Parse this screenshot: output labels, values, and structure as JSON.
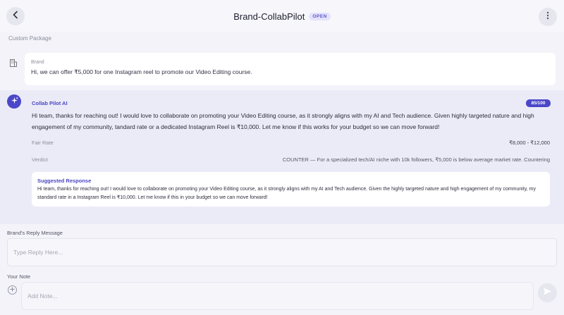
{
  "header": {
    "title": "Brand-CollabPilot",
    "status_badge": "OPEN",
    "back_icon": "chevron-left-icon",
    "menu_icon": "vertical-dots-icon"
  },
  "breadcrumb": "Custom Package",
  "brand_message": {
    "icon": "building-icon",
    "label": "Brand",
    "text": "Hi, we can offer ₹5,000 for one Instagram reel to promote our Video Editing course."
  },
  "ai_message": {
    "icon": "sparkles-icon",
    "name": "Collab Pilot AI",
    "score": "85/100",
    "text": "Hi team, thanks for reaching out! I would love to collaborate on promoting your Video Editing course, as it strongly aligns with my AI and Tech audience. Given highly targeted nature and high engagement of my community, tandard rate or a dedicated Instagram Reel is ₹10,000. Let me know if this works for your budget so we can move forward!",
    "fair_rate_label": "Fair Rate",
    "fair_rate_value": "₹8,000 - ₹12,000",
    "verdict_label": "Verdict",
    "verdict_value": "COUNTER — For a specialized tech/AI niche with 10k followers, ₹5,000 is below average market rate. Countering",
    "suggested": {
      "title": "Suggested Response",
      "text": "Hi team, thanks for reaching out! I would love to collaborate on promoting your Video Editing course, as it strongly aligns with my AI and Tech audience. Given the highly targeted nature and high engagement of my community, my standard rate in a Instagram Reel is ₹10,000. Let me know if this in your budget so we can move forward!"
    }
  },
  "reply": {
    "label": "Brand's Reply Message",
    "placeholder": "Type Reply Here..."
  },
  "note": {
    "label": "Your Note",
    "placeholder": "Add Note...",
    "add_icon": "plus-circle-icon",
    "send_icon": "send-icon"
  },
  "colors": {
    "accent": "#4b47c9",
    "page_bg": "#f3f3f9",
    "ai_bg": "#ebebf8"
  }
}
